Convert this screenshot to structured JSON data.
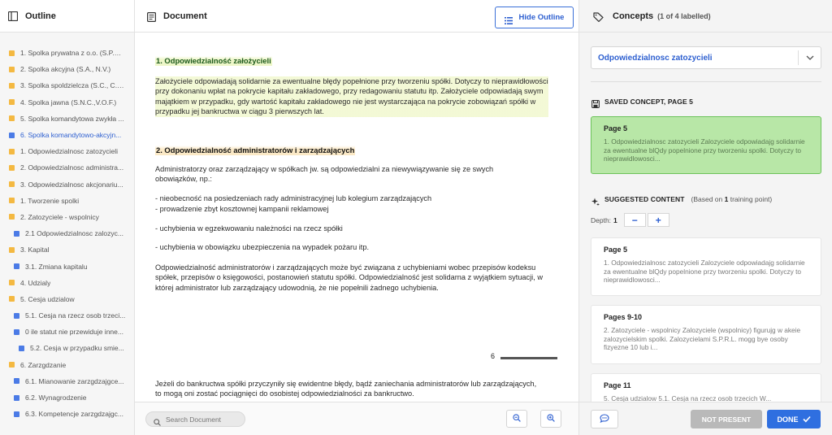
{
  "outline": {
    "title": "Outline",
    "items": [
      {
        "label": "1. Spolka prywatna z o.o. (S.P.R....",
        "color": "orange",
        "level": 0,
        "active": false
      },
      {
        "label": "2. Spolka akcyjna (S.A., N.V.)",
        "color": "orange",
        "level": 0,
        "active": false
      },
      {
        "label": "3. Spolka spoldzielcza (S.C., C.V.)",
        "color": "orange",
        "level": 0,
        "active": false
      },
      {
        "label": "4. Spolka jawna (S.N.C.,V.O.F.)",
        "color": "orange",
        "level": 0,
        "active": false
      },
      {
        "label": "5. Spolka komandytowa zwykła ...",
        "color": "orange",
        "level": 0,
        "active": false
      },
      {
        "label": "6. Spolka komandytowo-akcyjn...",
        "color": "blue",
        "level": 0,
        "active": true
      },
      {
        "label": "1. Odpowiedzialnosc zatozycieli",
        "color": "orange",
        "level": 0,
        "active": false
      },
      {
        "label": "2. Odpowiedzialnosc administra...",
        "color": "orange",
        "level": 0,
        "active": false
      },
      {
        "label": "3. Odpowiedzialnosc akcjonariu...",
        "color": "orange",
        "level": 0,
        "active": false
      },
      {
        "label": "1. Tworzenie spolki",
        "color": "orange",
        "level": 0,
        "active": false
      },
      {
        "label": "2. Zatozyciele - wspolnicy",
        "color": "orange",
        "level": 0,
        "active": false
      },
      {
        "label": "2.1 Odpowiedzialnosc zalozyc...",
        "color": "blue",
        "level": 1,
        "active": false
      },
      {
        "label": "3. Kapital",
        "color": "orange",
        "level": 0,
        "active": false
      },
      {
        "label": "3.1. Zmiana kapitalu",
        "color": "blue",
        "level": 1,
        "active": false
      },
      {
        "label": "4. Udzialy",
        "color": "orange",
        "level": 0,
        "active": false
      },
      {
        "label": "5. Cesja udzialow",
        "color": "orange",
        "level": 0,
        "active": false
      },
      {
        "label": "5.1. Cesja na rzecz osob trzeci...",
        "color": "blue",
        "level": 1,
        "active": false
      },
      {
        "label": "0 ile statut nie przewiduje inne...",
        "color": "blue",
        "level": 1,
        "active": false
      },
      {
        "label": "5.2. Cesja w przypadku smie...",
        "color": "blue",
        "level": 2,
        "active": false
      },
      {
        "label": "6. Zarzgdzanie",
        "color": "orange",
        "level": 0,
        "active": false
      },
      {
        "label": "6.1. Mianowanie zarzgdzajgce...",
        "color": "blue",
        "level": 1,
        "active": false
      },
      {
        "label": "6.2. Wynagrodzenie",
        "color": "blue",
        "level": 1,
        "active": false
      },
      {
        "label": "6.3. Kompetencje zarzgdzajgc...",
        "color": "blue",
        "level": 1,
        "active": false
      }
    ]
  },
  "document": {
    "title": "Document",
    "hide_outline_label": "Hide Outline",
    "section1_title": "1. Odpowiedzialność założycieli",
    "section1_para": "Założyciele odpowiadają solidarnie za ewentualne błędy popełnione przy tworzeniu spółki. Dotyczy to nieprawidłowości przy dokonaniu wpłat na pokrycie kapitału zakładowego, przy redagowaniu statutu itp. Założyciele odpowiadają swym majątkiem w przypadku, gdy wartość kapitału zakładowego nie jest wystarczająca na pokrycie zobowiązań spółki w przypadku jej bankructwa w ciągu 3 pierwszych lat.",
    "section2_title": "2. Odpowiedzialność administratorów i zarządzających",
    "section2_intro": "Administratorzy oraz zarządzający w spółkach jw. są odpowiedzialni za niewywiązywanie się ze swych obowiązków, np.:",
    "bullet1": "- nieobecność na posiedzeniach rady administracyjnej lub kolegium zarządzających",
    "bullet2": "- prowadzenie zbyt kosztownej kampanii reklamowej",
    "bullet3": "- uchybienia w egzekwowaniu należności na rzecz spółki",
    "bullet4": "- uchybienia w obowiązku ubezpieczenia na wypadek pożaru itp.",
    "section2_para": "Odpowiedzialność administratorów i zarządzających może być związana z uchybieniami wobec przepisów kodeksu spółek, przepisów o księgowości, postanowień statutu spółki. Odpowiedzialność jest solidarna z wyjątkiem sytuacji, w której administrator lub zarządzający udowodnią, że nie popełnili żadnego uchybienia.",
    "page_number": "6",
    "next_page_para": "Jeżeli do bankructwa spółki przyczyniły się ewidentne błędy, bądź zaniechania administratorów lub zarządzających, to mogą oni zostać pociągnięci do osobistej odpowiedzialności za bankructwo.",
    "search_placeholder": "Search Document"
  },
  "concepts": {
    "title": "Concepts",
    "count": "(1 of 4 labelled)",
    "selected_concept": "Odpowiedzialnosc zatozycieli",
    "saved_label": "SAVED CONCEPT, PAGE 5",
    "saved_card": {
      "title": "Page 5",
      "text": "1. Odpowiedzialnosc zatozycieli Zalozyciele odpowiadajg solidarnie za ewentualne blQdy popelnione przy tworzeniu spolki. Dotyczy to nieprawidlowosci..."
    },
    "suggested_label": "SUGGESTED CONTENT",
    "suggested_note_prefix": "(Based on ",
    "suggested_note_count": "1",
    "suggested_note_suffix": " training point)",
    "depth_label": "Depth:",
    "depth_value": "1",
    "minus": "−",
    "plus": "+",
    "suggestions": [
      {
        "title": "Page 5",
        "text": "1. Odpowiedzialnosc zatozycieli Zalozyciele odpowiadajg solidarnie za ewentualne blQdy popelnione przy tworzeniu spolki. Dotyczy to nieprawidlowosci..."
      },
      {
        "title": "Pages 9-10",
        "text": "2. Zatozyciele - wspolnicy Zalozyciele (wspolnicy) figurujg w akeie zalozycielskim spolki. Zalozycielami S.P.R.L. mogg bye osoby fizyezne 10 lub i..."
      },
      {
        "title": "Page 11",
        "text": "5. Cesja udzialow 5.1. Cesja na rzecz osob trzecich W..."
      }
    ],
    "not_present_label": "NOT PRESENT",
    "done_label": "DONE"
  },
  "colors": {
    "accent": "#2f6fe0",
    "highlight_green": "#b8e7a7",
    "outline_orange": "#f4b942",
    "outline_blue": "#4b7be6"
  }
}
